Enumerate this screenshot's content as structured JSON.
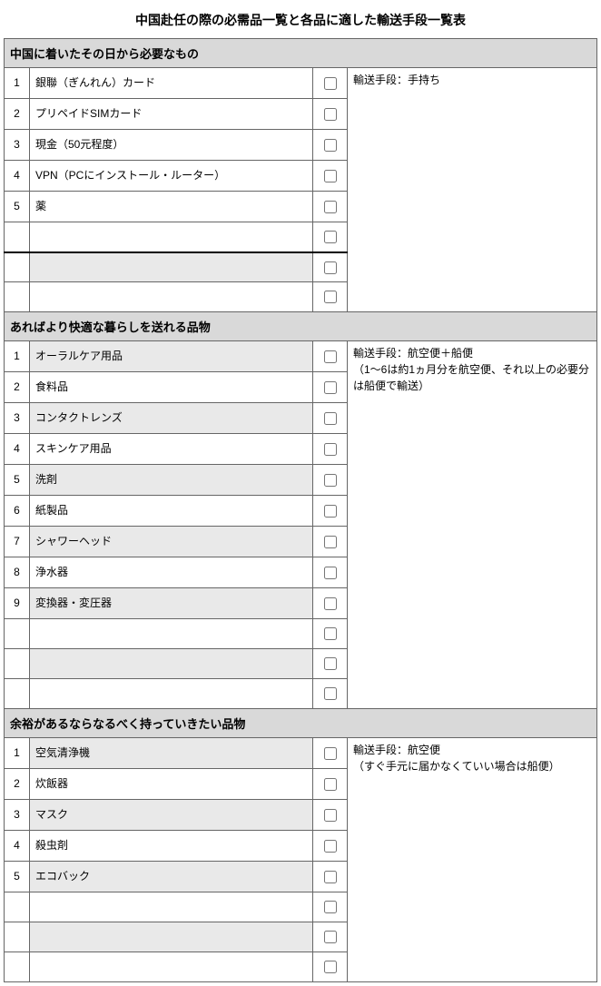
{
  "title": "中国赴任の際の必需品一覧と各品に適した輸送手段一覧表",
  "sections": [
    {
      "header": "中国に着いたその日から必要なもの",
      "note": "輸送手段：手持ち",
      "rows": [
        {
          "num": "1",
          "item": "銀聯（ぎんれん）カード",
          "alt": false
        },
        {
          "num": "2",
          "item": "プリペイドSIMカード",
          "alt": false
        },
        {
          "num": "3",
          "item": "現金（50元程度）",
          "alt": false
        },
        {
          "num": "4",
          "item": "VPN（PCにインストール・ルーター）",
          "alt": false
        },
        {
          "num": "5",
          "item": "薬",
          "alt": false
        },
        {
          "num": "",
          "item": "",
          "alt": false,
          "thick": true
        },
        {
          "num": "",
          "item": "",
          "alt": true
        },
        {
          "num": "",
          "item": "",
          "alt": false
        }
      ]
    },
    {
      "header": "あればより快適な暮らしを送れる品物",
      "note": "輸送手段：航空便＋船便\n（1～6は約1ヵ月分を航空便、それ以上の必要分は船便で輸送）",
      "rows": [
        {
          "num": "1",
          "item": "オーラルケア用品",
          "alt": true
        },
        {
          "num": "2",
          "item": "食料品",
          "alt": false
        },
        {
          "num": "3",
          "item": "コンタクトレンズ",
          "alt": true
        },
        {
          "num": "4",
          "item": "スキンケア用品",
          "alt": false
        },
        {
          "num": "5",
          "item": "洗剤",
          "alt": true
        },
        {
          "num": "6",
          "item": "紙製品",
          "alt": false
        },
        {
          "num": "7",
          "item": "シャワーヘッド",
          "alt": true
        },
        {
          "num": "8",
          "item": "浄水器",
          "alt": false
        },
        {
          "num": "9",
          "item": "変換器・変圧器",
          "alt": true
        },
        {
          "num": "",
          "item": "",
          "alt": false
        },
        {
          "num": "",
          "item": "",
          "alt": true
        },
        {
          "num": "",
          "item": "",
          "alt": false
        }
      ]
    },
    {
      "header": "余裕があるならなるべく持っていきたい品物",
      "note": "輸送手段：航空便\n（すぐ手元に届かなくていい場合は船便）",
      "rows": [
        {
          "num": "1",
          "item": "空気清浄機",
          "alt": true
        },
        {
          "num": "2",
          "item": "炊飯器",
          "alt": false
        },
        {
          "num": "3",
          "item": "マスク",
          "alt": true
        },
        {
          "num": "4",
          "item": "殺虫剤",
          "alt": false
        },
        {
          "num": "5",
          "item": "エコバック",
          "alt": true
        },
        {
          "num": "",
          "item": "",
          "alt": false
        },
        {
          "num": "",
          "item": "",
          "alt": true
        },
        {
          "num": "",
          "item": "",
          "alt": false
        }
      ]
    }
  ]
}
